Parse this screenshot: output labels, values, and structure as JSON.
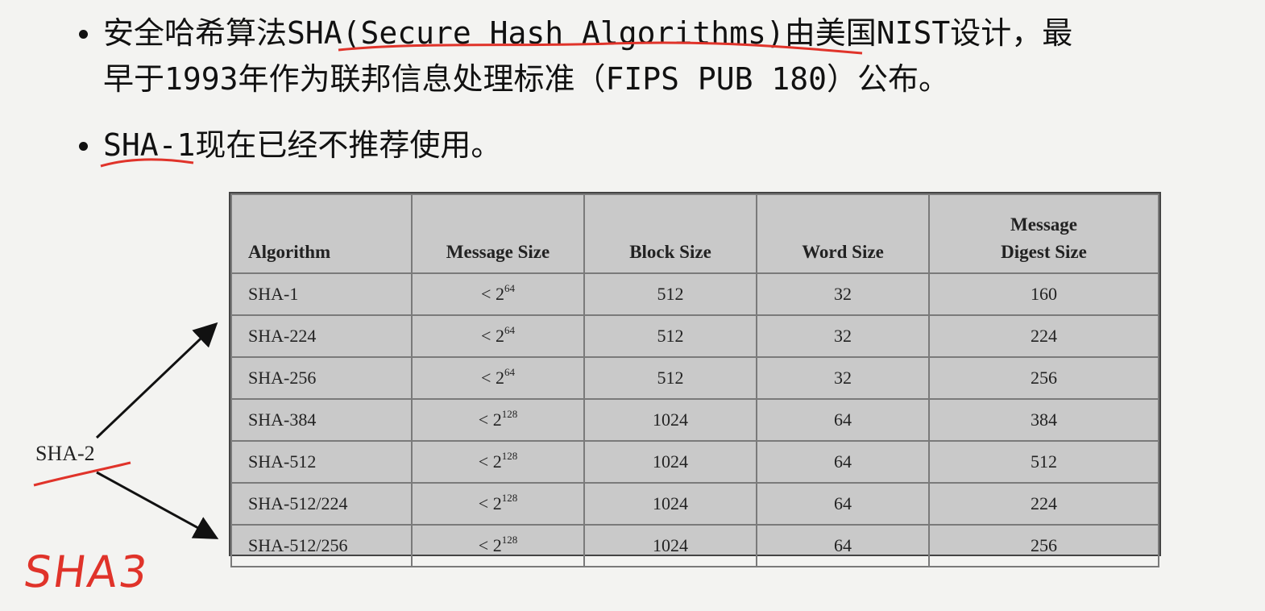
{
  "bullets": [
    {
      "line1": "安全哈希算法SHA(Secure Hash Algorithms)由美国NIST设计，最",
      "line2": "早于1993年作为联邦信息处理标准（FIPS PUB 180）公布。"
    },
    {
      "line1": "SHA-1现在已经不推荐使用。"
    }
  ],
  "table": {
    "headers": [
      "Algorithm",
      "Message Size",
      "Block Size",
      "Word Size",
      "Message\nDigest Size"
    ],
    "rows": [
      {
        "algorithm": "SHA-1",
        "msg_base": "< 2",
        "msg_exp": "64",
        "block": "512",
        "word": "32",
        "digest": "160"
      },
      {
        "algorithm": "SHA-224",
        "msg_base": "< 2",
        "msg_exp": "64",
        "block": "512",
        "word": "32",
        "digest": "224"
      },
      {
        "algorithm": "SHA-256",
        "msg_base": "< 2",
        "msg_exp": "64",
        "block": "512",
        "word": "32",
        "digest": "256"
      },
      {
        "algorithm": "SHA-384",
        "msg_base": "< 2",
        "msg_exp": "128",
        "block": "1024",
        "word": "64",
        "digest": "384"
      },
      {
        "algorithm": "SHA-512",
        "msg_base": "< 2",
        "msg_exp": "128",
        "block": "1024",
        "word": "64",
        "digest": "512"
      },
      {
        "algorithm": "SHA-512/224",
        "msg_base": "< 2",
        "msg_exp": "128",
        "block": "1024",
        "word": "64",
        "digest": "224"
      },
      {
        "algorithm": "SHA-512/256",
        "msg_base": "< 2",
        "msg_exp": "128",
        "block": "1024",
        "word": "64",
        "digest": "256"
      }
    ]
  },
  "labels": {
    "sha2": "SHA-2",
    "sha3_handwritten": "SHA3"
  },
  "colors": {
    "annotation": "#e0332a",
    "table_bg": "#c9c9c9",
    "page_bg": "#f3f3f1"
  }
}
